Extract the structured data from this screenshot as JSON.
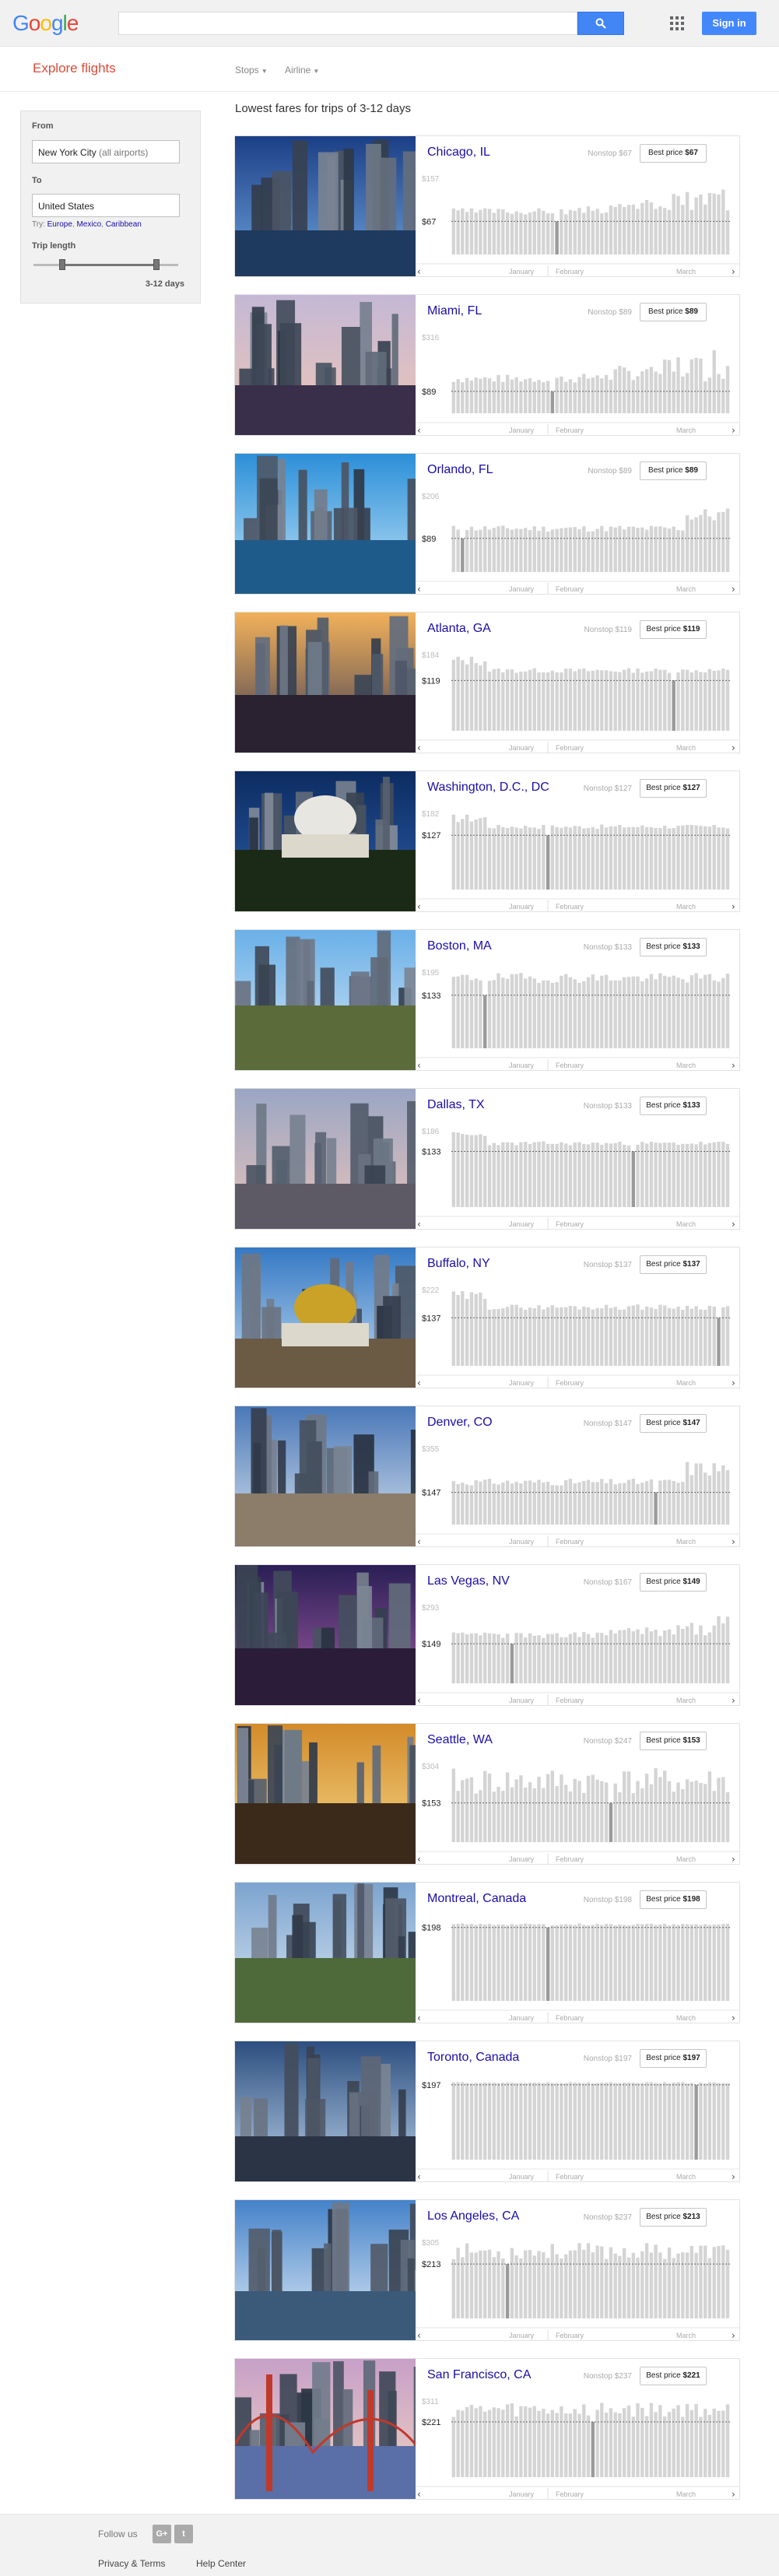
{
  "header": {
    "logo": "Google",
    "logo_colors": [
      "#4285f4",
      "#ea4335",
      "#fbbc05",
      "#4285f4",
      "#34a853",
      "#ea4335"
    ],
    "search_placeholder": "",
    "search_icon": "search-icon",
    "apps_icon": "apps-grid-icon",
    "signin_label": "Sign in"
  },
  "subheader": {
    "title": "Explore flights",
    "filters": [
      {
        "label": "Stops"
      },
      {
        "label": "Airline"
      }
    ]
  },
  "search_panel": {
    "from_label": "From",
    "from_value": "New York City",
    "from_suffix": "(all airports)",
    "to_label": "To",
    "to_value": "United States",
    "try_prefix": "Try:",
    "try_links": [
      "Europe",
      "Mexico",
      "Caribbean"
    ],
    "trip_length_label": "Trip length",
    "trip_length_value": "3-12 days",
    "trip_min_fraction": 0.2,
    "trip_max_fraction": 0.85
  },
  "results_heading": "Lowest fares for trips of 3-12 days",
  "chart_month_labels": [
    "January",
    "February",
    "March"
  ],
  "accent_colors": {
    "link": "#1a0dab",
    "brand_red": "#dd4b39",
    "button_blue": "#4387fd"
  },
  "destinations": [
    {
      "city": "Chicago, IL",
      "nonstop": "Nonstop $67",
      "best_label": "Best price",
      "best_price": "$67",
      "y_top": "$157",
      "y_low": "$67",
      "max": 157,
      "min": 67,
      "seed": 3,
      "pattern": "rise_end"
    },
    {
      "city": "Miami, FL",
      "nonstop": "Nonstop $89",
      "best_label": "Best price",
      "best_price": "$89",
      "y_top": "$316",
      "y_low": "$89",
      "max": 316,
      "min": 89,
      "seed": 7,
      "pattern": "rise_end"
    },
    {
      "city": "Orlando, FL",
      "nonstop": "Nonstop $89",
      "best_label": "Best price",
      "best_price": "$89",
      "y_top": "$206",
      "y_low": "$89",
      "max": 206,
      "min": 89,
      "seed": 11,
      "pattern": "flat_high_end"
    },
    {
      "city": "Atlanta, GA",
      "nonstop": "Nonstop $119",
      "best_label": "Best price",
      "best_price": "$119",
      "y_top": "$184",
      "y_low": "$119",
      "max": 184,
      "min": 119,
      "seed": 13,
      "pattern": "high_start"
    },
    {
      "city": "Washington, D.C., DC",
      "nonstop": "Nonstop $127",
      "best_label": "Best price",
      "best_price": "$127",
      "y_top": "$182",
      "y_low": "$127",
      "max": 182,
      "min": 127,
      "seed": 17,
      "pattern": "high_start"
    },
    {
      "city": "Boston, MA",
      "nonstop": "Nonstop $133",
      "best_label": "Best price",
      "best_price": "$133",
      "y_top": "$195",
      "y_low": "$133",
      "max": 195,
      "min": 133,
      "seed": 19,
      "pattern": "flat"
    },
    {
      "city": "Dallas, TX",
      "nonstop": "Nonstop $133",
      "best_label": "Best price",
      "best_price": "$133",
      "y_top": "$186",
      "y_low": "$133",
      "max": 186,
      "min": 133,
      "seed": 23,
      "pattern": "high_start"
    },
    {
      "city": "Buffalo, NY",
      "nonstop": "Nonstop $137",
      "best_label": "Best price",
      "best_price": "$137",
      "y_top": "$222",
      "y_low": "$137",
      "max": 222,
      "min": 137,
      "seed": 29,
      "pattern": "high_start"
    },
    {
      "city": "Denver, CO",
      "nonstop": "Nonstop $147",
      "best_label": "Best price",
      "best_price": "$147",
      "y_top": "$355",
      "y_low": "$147",
      "max": 355,
      "min": 147,
      "seed": 31,
      "pattern": "flat_high_end"
    },
    {
      "city": "Las Vegas, NV",
      "nonstop": "Nonstop $167",
      "best_label": "Best price",
      "best_price": "$149",
      "y_top": "$293",
      "y_low": "$149",
      "max": 293,
      "min": 149,
      "seed": 37,
      "pattern": "rise_end"
    },
    {
      "city": "Seattle, WA",
      "nonstop": "Nonstop $247",
      "best_label": "Best price",
      "best_price": "$153",
      "y_top": "$304",
      "y_low": "$153",
      "max": 304,
      "min": 153,
      "seed": 41,
      "pattern": "mixed"
    },
    {
      "city": "Montreal, Canada",
      "nonstop": "Nonstop $198",
      "best_label": "Best price",
      "best_price": "$198",
      "y_top": "",
      "y_low": "$198",
      "max": 210,
      "min": 198,
      "seed": 43,
      "pattern": "flat"
    },
    {
      "city": "Toronto, Canada",
      "nonstop": "Nonstop $197",
      "best_label": "Best price",
      "best_price": "$197",
      "y_top": "",
      "y_low": "$197",
      "max": 205,
      "min": 197,
      "seed": 47,
      "pattern": "flat"
    },
    {
      "city": "Los Angeles, CA",
      "nonstop": "Nonstop $237",
      "best_label": "Best price",
      "best_price": "$213",
      "y_top": "$305",
      "y_low": "$213",
      "max": 305,
      "min": 213,
      "seed": 53,
      "pattern": "mixed"
    },
    {
      "city": "San Francisco, CA",
      "nonstop": "Nonstop $237",
      "best_label": "Best price",
      "best_price": "$221",
      "y_top": "$311",
      "y_low": "$221",
      "max": 311,
      "min": 221,
      "seed": 59,
      "pattern": "mixed"
    }
  ],
  "footer": {
    "follow_label": "Follow us",
    "social": [
      {
        "label": "G+",
        "icon": "google-plus-icon"
      },
      {
        "label": "t",
        "icon": "twitter-icon"
      }
    ],
    "links": [
      "Privacy & Terms",
      "Help Center"
    ]
  }
}
